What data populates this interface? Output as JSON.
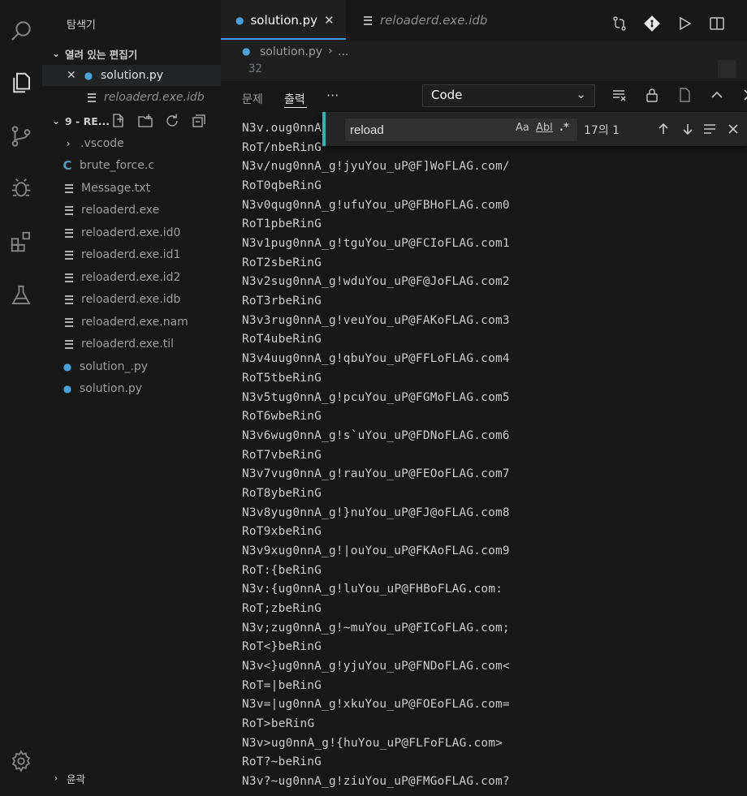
{
  "activity_bar": {
    "icons": [
      "search-icon",
      "explorer-icon",
      "source-control-icon",
      "debug-icon",
      "extensions-icon",
      "testing-icon",
      "settings-gear-icon"
    ]
  },
  "sidebar": {
    "title": "탐색기",
    "open_editors_label": "열려 있는 편집기",
    "open_editors": [
      {
        "name": "solution.py",
        "icon": "python-icon"
      },
      {
        "name": "reloaderd.exe.idb",
        "icon": "file-lines-icon"
      }
    ],
    "folder_label": "9 - RE...",
    "files": [
      {
        "name": ".vscode",
        "type": "folder"
      },
      {
        "name": "brute_force.c",
        "type": "c"
      },
      {
        "name": "Message.txt",
        "type": "text"
      },
      {
        "name": "reloaderd.exe",
        "type": "text"
      },
      {
        "name": "reloaderd.exe.id0",
        "type": "text"
      },
      {
        "name": "reloaderd.exe.id1",
        "type": "text"
      },
      {
        "name": "reloaderd.exe.id2",
        "type": "text"
      },
      {
        "name": "reloaderd.exe.idb",
        "type": "text"
      },
      {
        "name": "reloaderd.exe.nam",
        "type": "text"
      },
      {
        "name": "reloaderd.exe.til",
        "type": "text"
      },
      {
        "name": "solution_.py",
        "type": "python"
      },
      {
        "name": "solution.py",
        "type": "python"
      }
    ],
    "outline_label": "윤곽"
  },
  "tabs": [
    {
      "label": "solution.py",
      "active": true
    },
    {
      "label": "reloaderd.exe.idb",
      "active": false
    }
  ],
  "breadcrumb": {
    "file": "solution.py",
    "rest": "...",
    "line_number": "32"
  },
  "panel": {
    "tabs": [
      "문제",
      "출력"
    ],
    "active_tab": "출력",
    "more": "···",
    "output_channel": "Code"
  },
  "find_widget": {
    "query": "reload",
    "match_case": "Aa",
    "whole_word": "Abl",
    "regex": ".*",
    "match_count": "17의 1"
  },
  "output_lines": [
    "N3v.oug0nnA_g!",
    "RoT/nbeRinG",
    "N3v/nug0nnA_g!jyuYou_uP@F]WoFLAG.com/",
    "RoT0qbeRinG",
    "N3v0qug0nnA_g!ufuYou_uP@FBHoFLAG.com0",
    "RoT1pbeRinG",
    "N3v1pug0nnA_g!tguYou_uP@FCIoFLAG.com1",
    "RoT2sbeRinG",
    "N3v2sug0nnA_g!wduYou_uP@F@JoFLAG.com2",
    "RoT3rbeRinG",
    "N3v3rug0nnA_g!veuYou_uP@FAKoFLAG.com3",
    "RoT4ubeRinG",
    "N3v4uug0nnA_g!qbuYou_uP@FFLoFLAG.com4",
    "RoT5tbeRinG",
    "N3v5tug0nnA_g!pcuYou_uP@FGMoFLAG.com5",
    "RoT6wbeRinG",
    "N3v6wug0nnA_g!s`uYou_uP@FDNoFLAG.com6",
    "RoT7vbeRinG",
    "N3v7vug0nnA_g!rauYou_uP@FEOoFLAG.com7",
    "RoT8ybeRinG",
    "N3v8yug0nnA_g!}nuYou_uP@FJ@oFLAG.com8",
    "RoT9xbeRinG",
    "N3v9xug0nnA_g!|ouYou_uP@FKAoFLAG.com9",
    "RoT:{beRinG",
    "N3v:{ug0nnA_g!luYou_uP@FHBoFLAG.com:",
    "RoT;zbeRinG",
    "N3v;zug0nnA_g!~muYou_uP@FICoFLAG.com;",
    "RoT<}beRinG",
    "N3v<}ug0nnA_g!yjuYou_uP@FNDoFLAG.com<",
    "RoT=|beRinG",
    "N3v=|ug0nnA_g!xkuYou_uP@FOEoFLAG.com=",
    "RoT>beRinG",
    "N3v>ug0nnA_g!{huYou_uP@FLFoFLAG.com>",
    "RoT?~beRinG",
    "N3v?~ug0nnA_g!ziuYou_uP@FMGoFLAG.com?"
  ]
}
